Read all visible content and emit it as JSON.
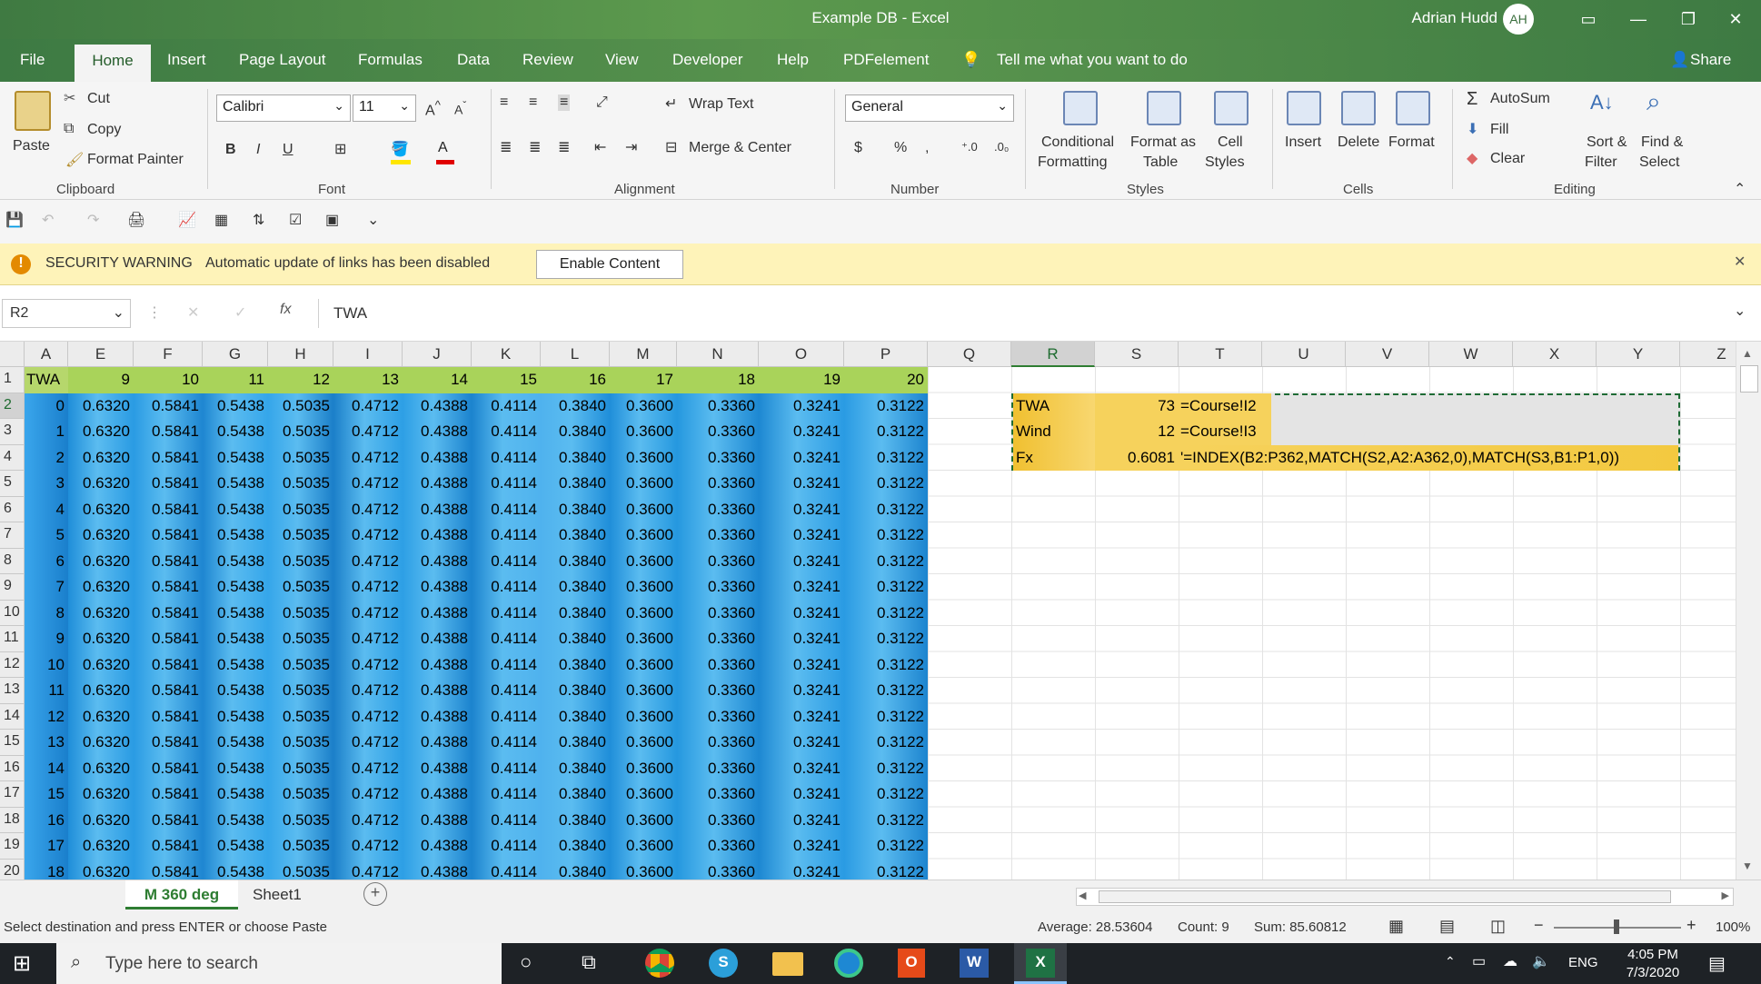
{
  "window": {
    "title": "Example DB  -  Excel",
    "user_name": "Adrian Hudd",
    "user_initials": "AH"
  },
  "tabs": [
    "File",
    "Home",
    "Insert",
    "Page Layout",
    "Formulas",
    "Data",
    "Review",
    "View",
    "Developer",
    "Help",
    "PDFelement"
  ],
  "tell_me": "Tell me what you want to do",
  "share_label": "Share",
  "clipboard": {
    "paste": "Paste",
    "cut": "Cut",
    "copy": "Copy",
    "format_painter": "Format Painter",
    "group": "Clipboard"
  },
  "font": {
    "name": "Calibri",
    "size": "11",
    "group": "Font"
  },
  "alignment": {
    "wrap_text": "Wrap Text",
    "merge_center": "Merge & Center",
    "group": "Alignment"
  },
  "number": {
    "format": "General",
    "group": "Number"
  },
  "styles": {
    "conditional": "Conditional",
    "conditional2": "Formatting",
    "format_as": "Format as",
    "format_as2": "Table",
    "cell": "Cell",
    "cell2": "Styles",
    "group": "Styles"
  },
  "cells": {
    "insert": "Insert",
    "delete": "Delete",
    "format": "Format",
    "group": "Cells"
  },
  "editing": {
    "autosum": "AutoSum",
    "fill": "Fill",
    "clear": "Clear",
    "sort": "Sort &",
    "sort2": "Filter",
    "find": "Find &",
    "find2": "Select",
    "group": "Editing"
  },
  "security": {
    "title": "SECURITY WARNING",
    "message": "Automatic update of links has been disabled",
    "button": "Enable Content"
  },
  "formula_bar": {
    "name_box": "R2",
    "formula": "TWA"
  },
  "columns": [
    "A",
    "E",
    "F",
    "G",
    "H",
    "I",
    "J",
    "K",
    "L",
    "M",
    "N",
    "O",
    "P",
    "Q",
    "R",
    "S",
    "T",
    "U",
    "V",
    "W",
    "X",
    "Y",
    "Z"
  ],
  "header_row": [
    "TWA",
    "9",
    "10",
    "11",
    "12",
    "13",
    "14",
    "15",
    "16",
    "17",
    "18",
    "19",
    "20"
  ],
  "row_values": [
    "0.6320",
    "0.5841",
    "0.5438",
    "0.5035",
    "0.4712",
    "0.4388",
    "0.4114",
    "0.3840",
    "0.3600",
    "0.3360",
    "0.3241",
    "0.3122"
  ],
  "twa_values": [
    "0",
    "1",
    "2",
    "3",
    "4",
    "5",
    "6",
    "7",
    "8",
    "9",
    "10",
    "11",
    "12",
    "13",
    "14",
    "15",
    "16",
    "17",
    "18"
  ],
  "row_numbers": [
    "1",
    "2",
    "3",
    "4",
    "5",
    "6",
    "7",
    "8",
    "9",
    "10",
    "11",
    "12",
    "13",
    "14",
    "15",
    "16",
    "17",
    "18",
    "19",
    "20"
  ],
  "lookup": [
    {
      "label": "TWA",
      "value": "73",
      "formula": "=Course!I2"
    },
    {
      "label": "Wind",
      "value": "12",
      "formula": "=Course!I3"
    },
    {
      "label": "Fx",
      "value": "0.6081",
      "formula": "'=INDEX(B2:P362,MATCH(S2,A2:A362,0),MATCH(S3,B1:P1,0))"
    }
  ],
  "sheets": {
    "active": "M 360 deg",
    "other": "Sheet1"
  },
  "status": {
    "message": "Select destination and press ENTER or choose Paste",
    "average": "Average: 28.53604",
    "count": "Count: 9",
    "sum": "Sum: 85.60812",
    "zoom": "100%"
  },
  "taskbar": {
    "search_placeholder": "Type here to search",
    "lang": "ENG",
    "time": "4:05 PM",
    "date": "7/3/2020"
  }
}
